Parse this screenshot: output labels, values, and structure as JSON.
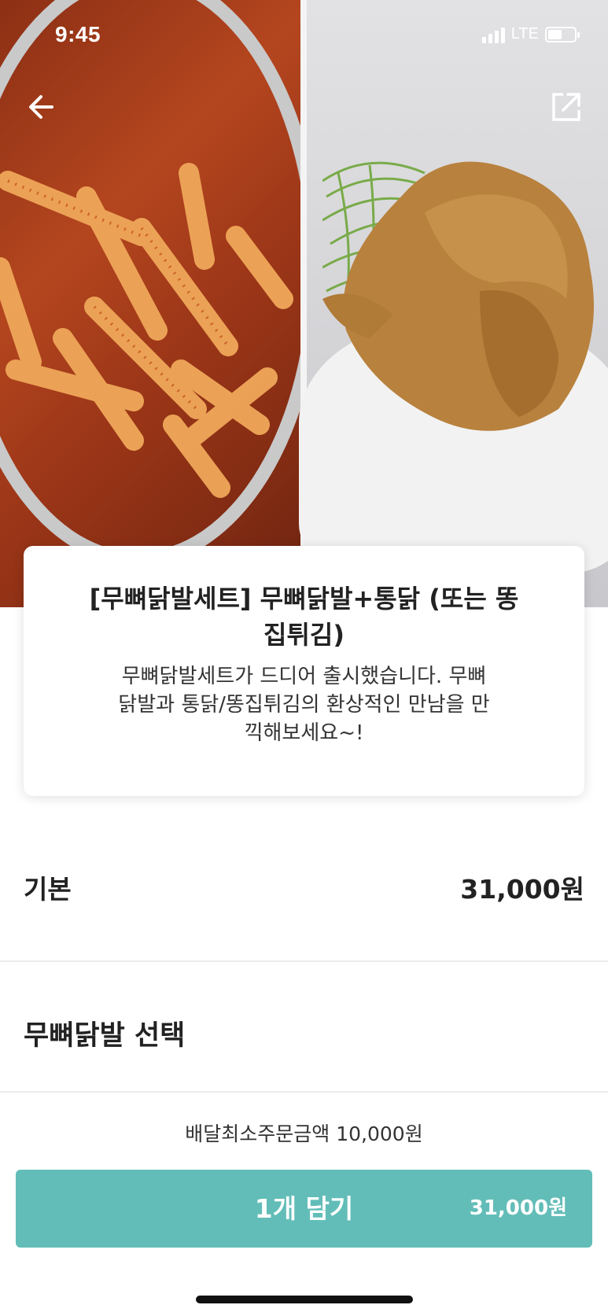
{
  "status_bar": {
    "time": "9:45",
    "network": "LTE",
    "battery_level": 0.52
  },
  "header": {
    "back_icon": "arrow-left-icon",
    "share_icon": "share-external-icon"
  },
  "product": {
    "title": "[무뼈닭발세트] 무뼈닭발+통닭 (또는 똥집튀김)",
    "description": "무뼈닭발세트가 드디어 출시했습니다. 무뼈닭발과 통닭/똥집튀김의 환상적인 만남을 만끽해보세요~!"
  },
  "base": {
    "label": "기본",
    "price": "31,000원"
  },
  "option_section": {
    "title": "무뼈닭발 선택"
  },
  "footer": {
    "min_order": "배달최소주문금액 10,000원",
    "cta_label": "1개 담기",
    "cta_price": "31,000원"
  },
  "colors": {
    "accent": "#62bdb8",
    "text": "#222222",
    "divider": "#ececec"
  }
}
